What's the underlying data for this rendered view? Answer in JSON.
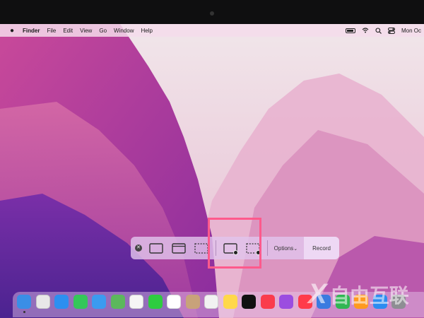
{
  "menubar": {
    "apple_icon": "apple-logo-icon",
    "app_name": "Finder",
    "menus": [
      "File",
      "Edit",
      "View",
      "Go",
      "Window",
      "Help"
    ],
    "status_icons": [
      "battery-icon",
      "wifi-icon",
      "search-icon",
      "control-center-icon"
    ],
    "clock": "Mon Oc"
  },
  "toolbar": {
    "close_icon": "close-icon",
    "buttons": [
      {
        "name": "capture-entire-screen-icon"
      },
      {
        "name": "capture-window-icon"
      },
      {
        "name": "capture-selection-icon"
      },
      {
        "name": "record-entire-screen-icon"
      },
      {
        "name": "record-selection-icon"
      }
    ],
    "options_label": "Options",
    "record_label": "Record"
  },
  "highlight_color": "#ff5a8c",
  "dock": {
    "apps": [
      {
        "name": "finder-icon",
        "color": "#3a8ee6"
      },
      {
        "name": "launchpad-icon",
        "color": "#e8e8e8"
      },
      {
        "name": "safari-icon",
        "color": "#2d8ff0"
      },
      {
        "name": "messages-icon",
        "color": "#34c759"
      },
      {
        "name": "mail-icon",
        "color": "#3b9bf0"
      },
      {
        "name": "maps-icon",
        "color": "#5cb85c"
      },
      {
        "name": "photos-icon",
        "color": "#f5f5f5"
      },
      {
        "name": "facetime-icon",
        "color": "#2ecc40"
      },
      {
        "name": "calendar-icon",
        "color": "#ffffff"
      },
      {
        "name": "contacts-icon",
        "color": "#c8a27a"
      },
      {
        "name": "reminders-icon",
        "color": "#f2f2f2"
      },
      {
        "name": "notes-icon",
        "color": "#ffd84a"
      },
      {
        "name": "apple-tv-icon",
        "color": "#111111"
      },
      {
        "name": "music-icon",
        "color": "#fa3c4c"
      },
      {
        "name": "podcasts-icon",
        "color": "#9b4de0"
      },
      {
        "name": "news-icon",
        "color": "#ff3b4a"
      },
      {
        "name": "keynote-icon",
        "color": "#3a7be0"
      },
      {
        "name": "numbers-icon",
        "color": "#30b653"
      },
      {
        "name": "pages-icon",
        "color": "#ff9a1f"
      },
      {
        "name": "app-store-icon",
        "color": "#2d8cf0"
      },
      {
        "name": "system-preferences-icon",
        "color": "#8e8e93"
      }
    ]
  },
  "watermark_brand": "自由互联"
}
